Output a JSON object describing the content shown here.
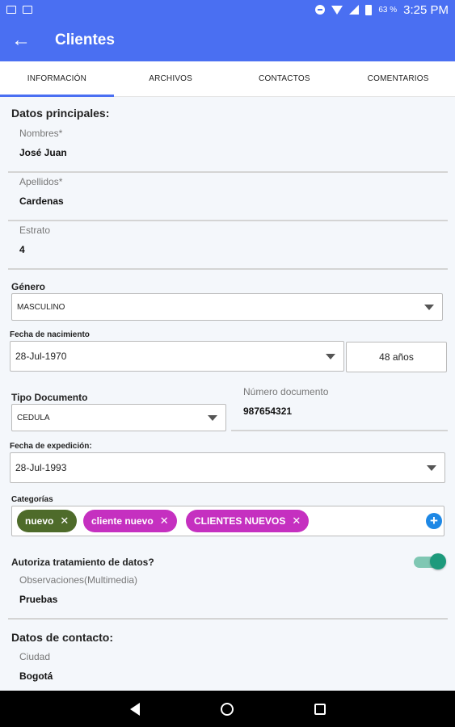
{
  "statusbar": {
    "battery": "63 %",
    "time": "3:25 PM"
  },
  "appbar": {
    "title": "Clientes"
  },
  "tabs": [
    "INFORMACIÓN",
    "ARCHIVOS",
    "CONTACTOS",
    "COMENTARIOS"
  ],
  "active_tab": "INFORMACIÓN",
  "main": {
    "section_principal": "Datos principales:",
    "nombres_label": "Nombres*",
    "nombres_value": "José Juan",
    "apellidos_label": "Apellidos*",
    "apellidos_value": "Cardenas",
    "estrato_label": "Estrato",
    "estrato_value": "4",
    "genero_label": "Género",
    "genero_value": "MASCULINO",
    "fecha_nac_label": "Fecha de nacimiento",
    "fecha_nac_value": "28-Jul-1970",
    "edad_value": "48 años",
    "tipo_doc_label": "Tipo Documento",
    "tipo_doc_value": "CEDULA",
    "num_doc_label": "Número documento",
    "num_doc_value": "987654321",
    "fecha_exp_label": "Fecha de expedición:",
    "fecha_exp_value": "28-Jul-1993",
    "categorias_label": "Categorías",
    "categorias": [
      {
        "label": "nuevo",
        "color": "#4e6b2a"
      },
      {
        "label": "cliente nuevo",
        "color": "#c530c0"
      },
      {
        "label": "CLIENTES NUEVOS",
        "color": "#c530c0"
      }
    ],
    "autoriza_label": "Autoriza tratamiento de datos?",
    "autoriza_value": true,
    "observaciones_label": "Observaciones(Multimedia)",
    "observaciones_value": "Pruebas",
    "section_contacto": "Datos de contacto:",
    "ciudad_label": "Ciudad",
    "ciudad_value": "Bogotá"
  },
  "colors": {
    "primary": "#4a6ff2",
    "toggle_on": "#1d9a7c"
  }
}
